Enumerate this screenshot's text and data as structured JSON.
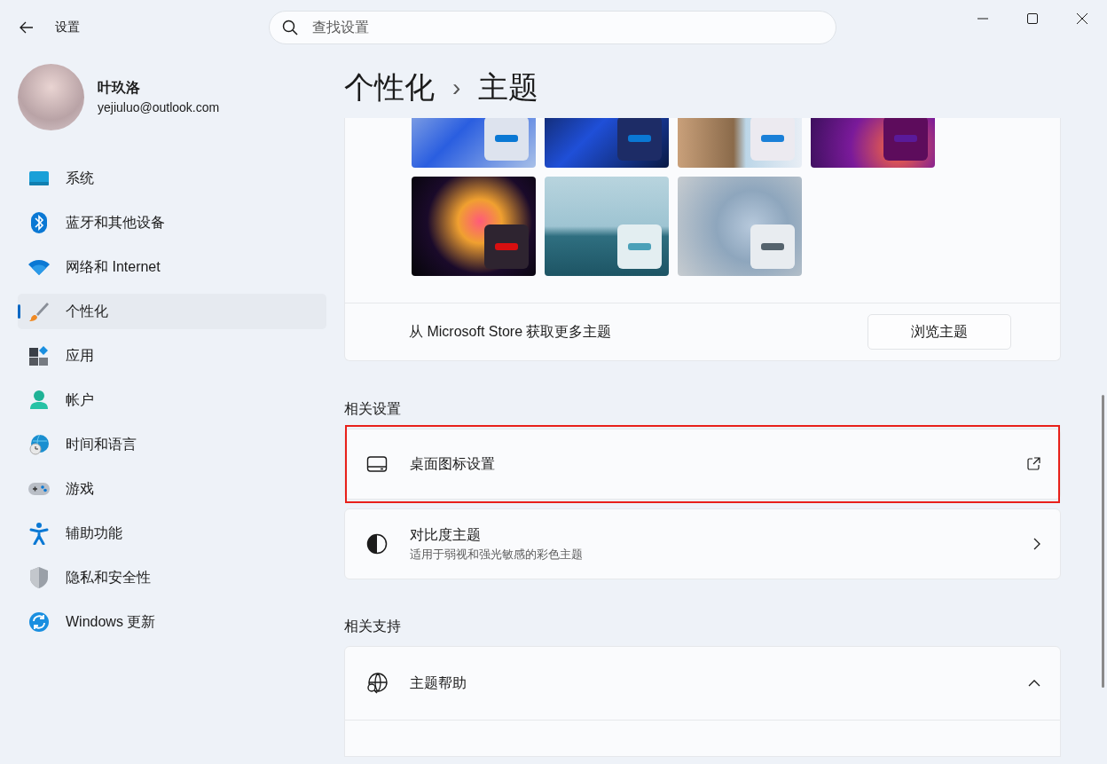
{
  "window": {
    "title": "设置"
  },
  "search": {
    "placeholder": "查找设置"
  },
  "account": {
    "name": "叶玖洛",
    "email": "yejiuluo@outlook.com"
  },
  "sidebar": {
    "items": [
      {
        "label": "系统",
        "selected": false
      },
      {
        "label": "蓝牙和其他设备",
        "selected": false
      },
      {
        "label": "网络和 Internet",
        "selected": false
      },
      {
        "label": "个性化",
        "selected": true
      },
      {
        "label": "应用",
        "selected": false
      },
      {
        "label": "帐户",
        "selected": false
      },
      {
        "label": "时间和语言",
        "selected": false
      },
      {
        "label": "游戏",
        "selected": false
      },
      {
        "label": "辅助功能",
        "selected": false
      },
      {
        "label": "隐私和安全性",
        "selected": false
      },
      {
        "label": "Windows 更新",
        "selected": false
      }
    ]
  },
  "breadcrumb": {
    "parent": "个性化",
    "separator": "›",
    "current": "主题"
  },
  "themes": [
    {
      "color": "#0a78d4"
    },
    {
      "color": "#0a78d4"
    },
    {
      "color": "#1a80d8"
    },
    {
      "color": "#5a1a9a"
    },
    {
      "color": "#d80f10"
    },
    {
      "color": "#4aa0b8"
    },
    {
      "color": "#55636d"
    }
  ],
  "store": {
    "text": "从 Microsoft Store 获取更多主题",
    "button": "浏览主题"
  },
  "related_settings": {
    "heading": "相关设置",
    "items": [
      {
        "kind": "external",
        "title": "桌面图标设置",
        "highlighted": true
      },
      {
        "kind": "navigate",
        "title": "对比度主题",
        "subtitle": "适用于弱视和强光敏感的彩色主题",
        "highlighted": false
      }
    ]
  },
  "related_support": {
    "heading": "相关支持",
    "items": [
      {
        "title": "主题帮助",
        "expanded": true
      }
    ]
  }
}
